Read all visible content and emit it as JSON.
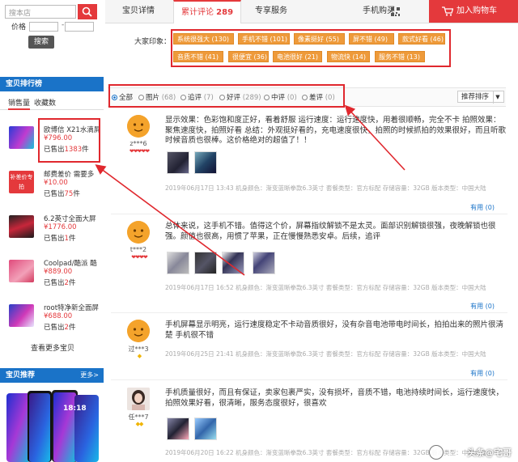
{
  "left": {
    "search_placeholder": "搜本店",
    "price_label": "价格",
    "price_dash": "-",
    "search_button": "搜索",
    "rank_title": "宝贝排行榜",
    "rank_tabs": [
      "销售量",
      "收藏数"
    ],
    "rank_items": [
      {
        "name": "欧博信 X21水滴屏",
        "price": "¥796.00",
        "sold_prefix": "已售出",
        "sold": "1383",
        "sold_unit": "件"
      },
      {
        "name": "邮费差价 需要多",
        "price": "¥10.00",
        "sold_prefix": "已售出",
        "sold": "75",
        "sold_unit": "件"
      },
      {
        "name": "6.2英寸全面大屏",
        "price": "¥1776.00",
        "sold_prefix": "已售出",
        "sold": "1",
        "sold_unit": "件"
      },
      {
        "name": "Coolpad/酷派 酷",
        "price": "¥889.00",
        "sold_prefix": "已售出",
        "sold": "2",
        "sold_unit": "件"
      },
      {
        "name": "root特净新全面屏",
        "price": "¥688.00",
        "sold_prefix": "已售出",
        "sold": "2",
        "sold_unit": "件"
      }
    ],
    "rank_thumb_label": "补差价专拍",
    "more_link": "查看更多宝贝",
    "recommend_title": "宝贝推荐",
    "recommend_more": "更多>",
    "phone_time": "18:18"
  },
  "tabs": {
    "detail": "宝贝详情",
    "reviews_label": "累计评论",
    "reviews_count": "289",
    "service": "专享服务",
    "mobile_buy": "手机购买",
    "add_to_cart": "加入购物车"
  },
  "impressions": {
    "label": "大家印象：",
    "tags": [
      "系统很强大 (130)",
      "手机不错 (101)",
      "像素挺好 (55)",
      "屏不错 (49)",
      "款式好看 (46)",
      "音质不错 (41)",
      "很便宜 (36)",
      "电池很好 (21)",
      "物流快 (14)",
      "服务不错 (13)"
    ]
  },
  "filters": {
    "options": [
      {
        "label": "全部",
        "count": ""
      },
      {
        "label": "图片",
        "count": "(68)"
      },
      {
        "label": "追评",
        "count": "(7)"
      },
      {
        "label": "好评",
        "count": "(289)"
      },
      {
        "label": "中评",
        "count": "(0)"
      },
      {
        "label": "差评",
        "count": "(0)"
      }
    ],
    "sort_label": "推荐排序",
    "sort_arrow": "▼"
  },
  "reviews": [
    {
      "user": "z***6",
      "badges": "❤❤❤❤❤",
      "text": "显示效果：色彩饱和度正好，看着舒服 运行速度：运行速度快，用着很顺畅，完全不卡 拍照效果：聚焦速度快，拍照好看 总结：外观挺好看的，充电速度很快，拍照的时候抓拍的效果很好，而且听歌时候音质也很棒。这价格绝对的超值了！！",
      "meta": "2019年06月17日 13:43   机身颜色：渐变蓝晰拳款6.3英寸   套餐类型：官方标配   存储容量：32GB   版本类型：中国大陆",
      "useful": "有用 (0)"
    },
    {
      "user": "t***2",
      "badges": "❤❤❤❤",
      "text": "总体来说，这手机不错。值得这个价，屏幕指纹解锁不是太灵。面部识别解锁很强，夜晚解锁也很强。颜值也很高，用惯了苹果，正在慢慢熟悉安卓。后续，追评",
      "meta": "2019年06月17日 16:52   机身颜色：渐变蓝晰拳款6.3英寸   套餐类型：官方标配   存储容量：32GB   版本类型：中国大陆",
      "useful": "有用 (0)"
    },
    {
      "user": "过***3",
      "badges": "◆",
      "text": "手机屏幕显示明亮，运行速度稳定不卡动音质很好，没有杂音电池带电时间长，拍拍出来的照片很清楚 手机很不错",
      "meta": "2019年06月25日 21:41   机身颜色：渐变蓝晰拳款6.3英寸   套餐类型：官方标配   存储容量：32GB   版本类型：中国大陆",
      "useful": "有用 (0)"
    },
    {
      "user": "任***7",
      "badges": "◆◆",
      "text": "手机质量很好，而且有保证，卖家包裹严实，没有损坏，音质不错，电池持续时间长，运行速度快，拍照效果好看，很清晰，服务态度很好，很喜欢",
      "meta": "2019年06月20日 16:22   机身颜色：渐变蓝晰拳款6.3英寸   套餐类型：官方标配   存储容量：32GB   版本类型：中国大陆",
      "useful": "有用 (0)"
    }
  ],
  "watermark": "头条@宅哥"
}
